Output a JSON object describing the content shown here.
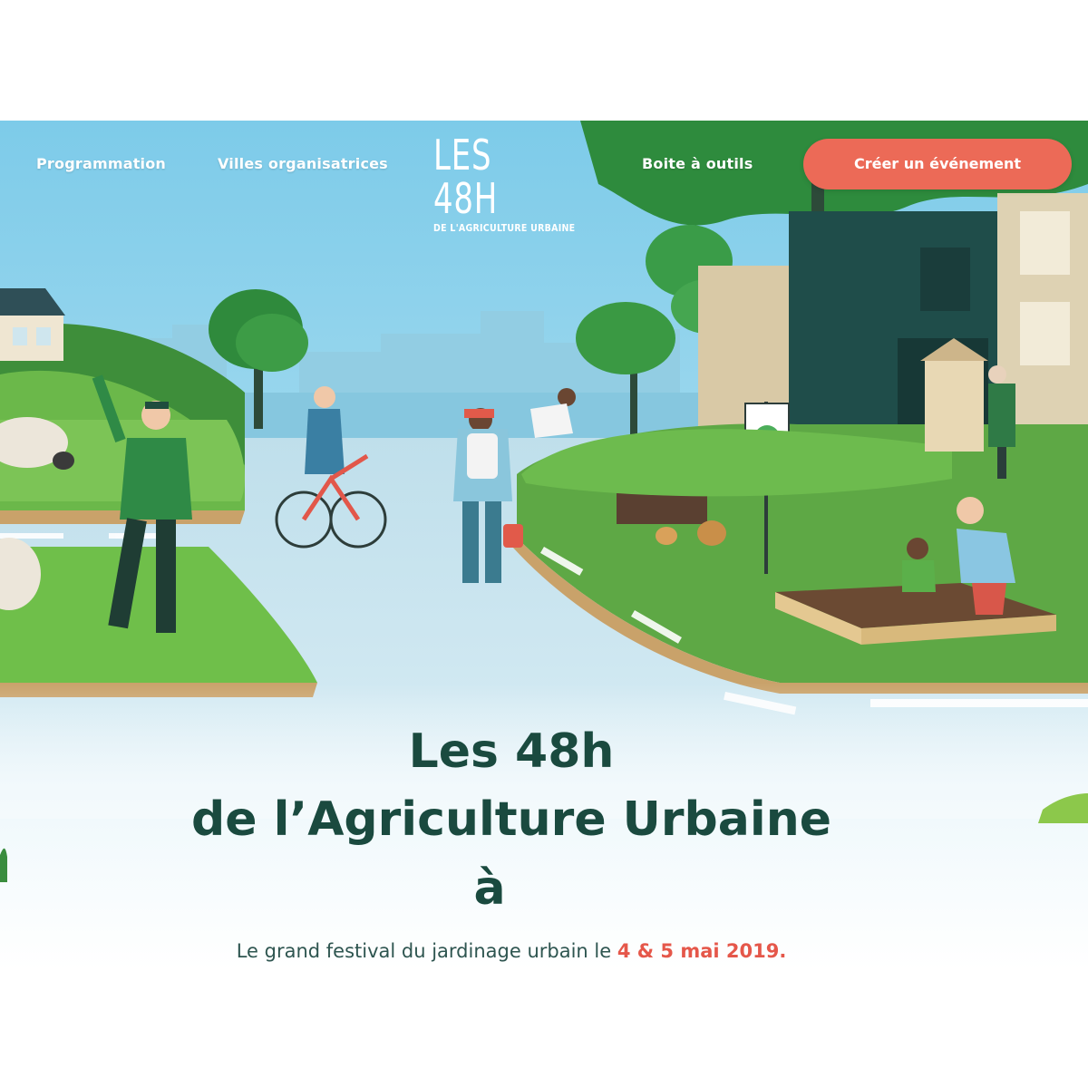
{
  "nav": {
    "left_links": [
      "Programmation",
      "Villes organisatrices"
    ],
    "right_link": "Boite à outils",
    "cta_label": "Créer un événement"
  },
  "logo": {
    "main": "LES 48H",
    "sub": "DE L'AGRICULTURE URBAINE"
  },
  "hero": {
    "title_line_1": "Les 48h",
    "title_line_2": "de l’Agriculture Urbaine",
    "title_line_3": "à",
    "subtitle_prefix": "Le grand festival du jardinage urbain le ",
    "subtitle_date": "4 & 5 mai 2019."
  },
  "colors": {
    "accent": "#ec6a57",
    "title": "#1a4a3f",
    "date": "#e5574a",
    "sky": "#8fd3ee",
    "grass": "#5fb04a",
    "road": "#cfe6f0"
  }
}
